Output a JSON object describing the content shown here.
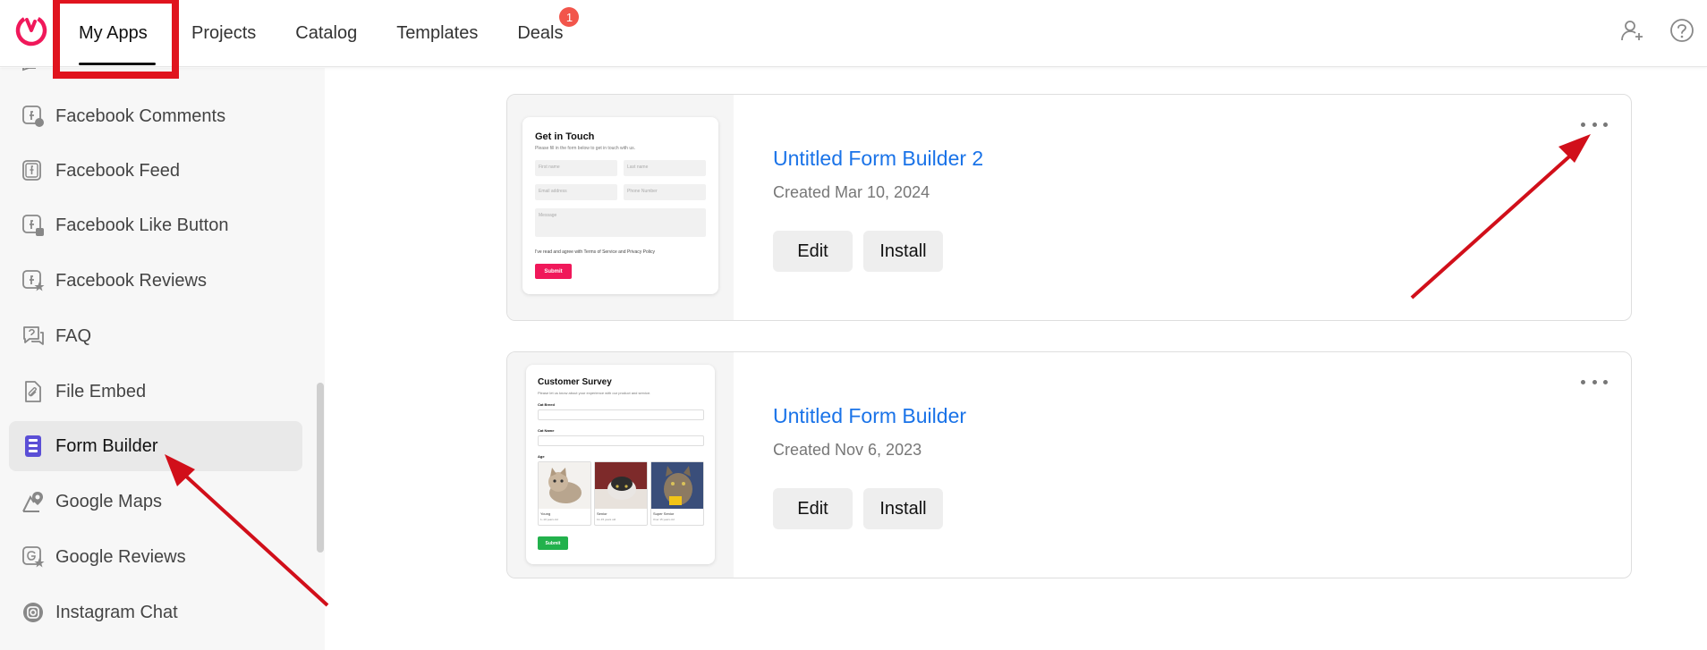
{
  "nav": {
    "items": [
      {
        "label": "My Apps"
      },
      {
        "label": "Projects"
      },
      {
        "label": "Catalog"
      },
      {
        "label": "Templates"
      },
      {
        "label": "Deals"
      }
    ],
    "deals_badge": "1",
    "active": "My Apps"
  },
  "sidebar": {
    "items": [
      {
        "label": "Facebook Comments",
        "icon": "facebook-comments-icon"
      },
      {
        "label": "Facebook Feed",
        "icon": "facebook-feed-icon"
      },
      {
        "label": "Facebook Like Button",
        "icon": "facebook-like-icon"
      },
      {
        "label": "Facebook Reviews",
        "icon": "facebook-reviews-icon"
      },
      {
        "label": "FAQ",
        "icon": "faq-icon"
      },
      {
        "label": "File Embed",
        "icon": "file-embed-icon"
      },
      {
        "label": "Form Builder",
        "icon": "form-builder-icon"
      },
      {
        "label": "Google Maps",
        "icon": "google-maps-icon"
      },
      {
        "label": "Google Reviews",
        "icon": "google-reviews-icon"
      },
      {
        "label": "Instagram Chat",
        "icon": "instagram-chat-icon"
      }
    ],
    "active": "Form Builder"
  },
  "cards": [
    {
      "title": "Untitled Form Builder 2",
      "created": "Created Mar 10, 2024",
      "edit_label": "Edit",
      "install_label": "Install",
      "thumb": {
        "heading": "Get in Touch",
        "sub": "Please fill in the form below to get in touch with us.",
        "first_name": "First name",
        "last_name": "Last name",
        "email": "Email address",
        "phone": "Phone Number",
        "message": "Message",
        "agree": "I've read and agree with Terms of Service and Privacy Policy",
        "submit": "Submit"
      }
    },
    {
      "title": "Untitled Form Builder",
      "created": "Created Nov 6, 2023",
      "edit_label": "Edit",
      "install_label": "Install",
      "thumb": {
        "heading": "Customer Survey",
        "sub": "Please let us know about your experience with our product and service.",
        "label1": "Cat Breed",
        "label2": "Cat Name",
        "label3": "Age",
        "opt1": "Young",
        "opt1_sub": "1–10 years old",
        "opt2": "Senior",
        "opt2_sub": "11–15 years old",
        "opt3": "Super Senior",
        "opt3_sub": "Over 15 years old",
        "submit": "Submit"
      }
    }
  ],
  "colors": {
    "accent_link": "#1a73e8",
    "highlight_red": "#e0141e",
    "badge": "#f2554b",
    "form_submit_pink": "#f0185a",
    "form_submit_green": "#22b14c",
    "form_builder_icon": "#5b4fd6"
  },
  "icons": {
    "logo": "brand-logo-icon",
    "add_user": "add-user-icon",
    "help": "help-icon",
    "more": "more-options-icon"
  }
}
